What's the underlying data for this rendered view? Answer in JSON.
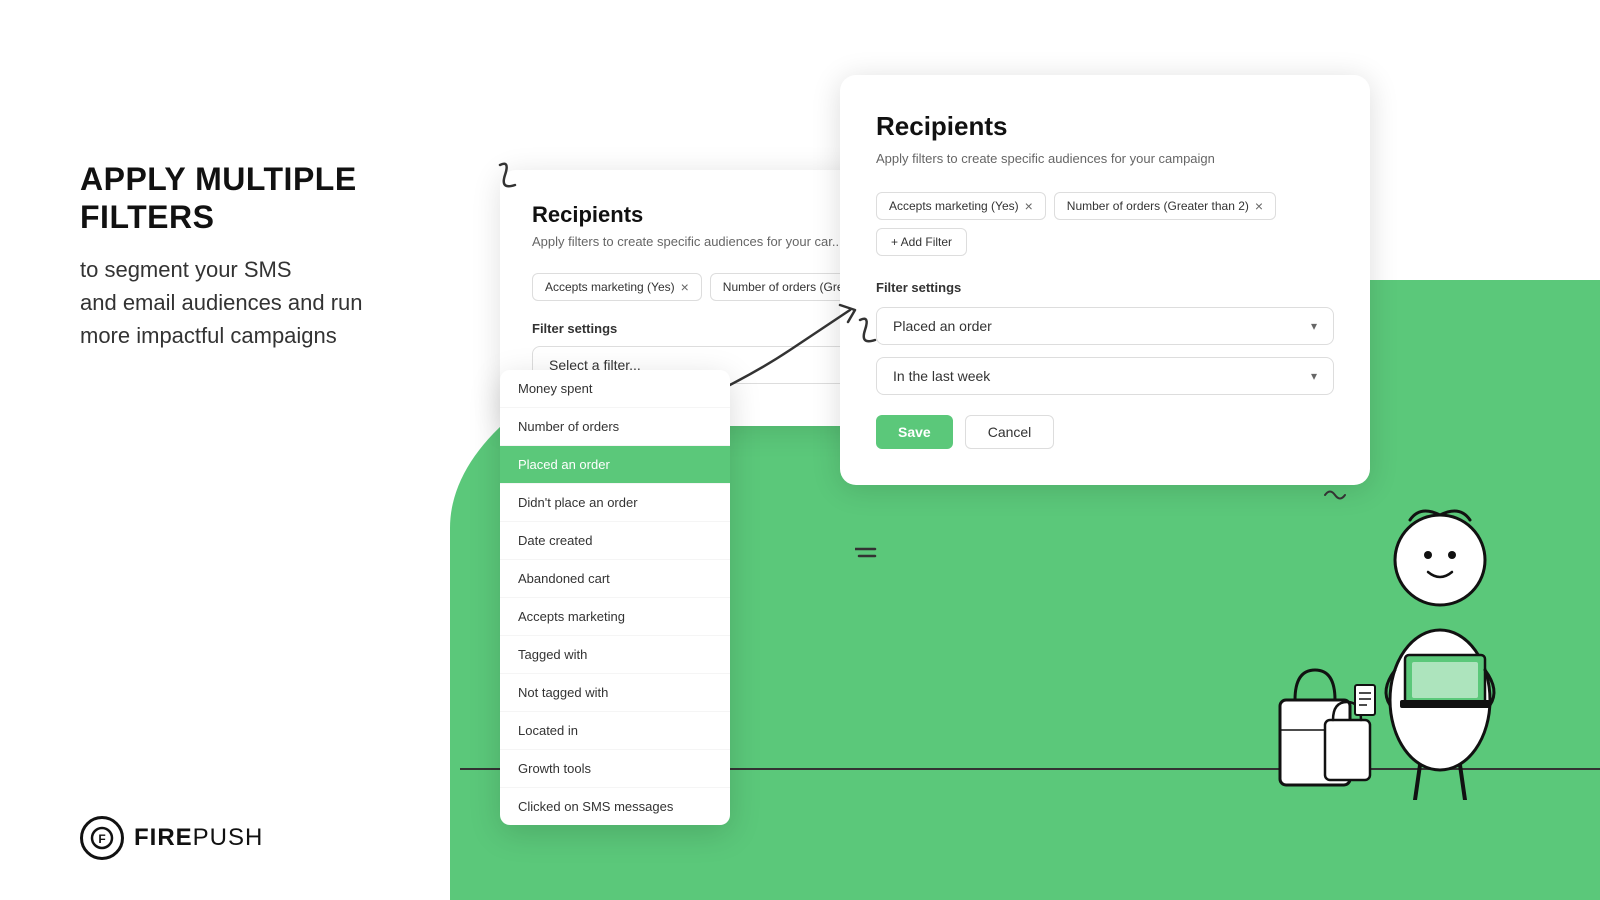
{
  "left": {
    "headline": "APPLY MULTIPLE FILTERS",
    "body_line1": "to segment your SMS",
    "body_line2": "and email audiences and run",
    "body_line3": "more impactful campaigns"
  },
  "logo": {
    "icon": "F",
    "name_bold": "FIRE",
    "name_light": "PUSH"
  },
  "card_back": {
    "title": "Recipients",
    "subtitle": "Apply filters to create specific audiences for your car...",
    "tags": [
      {
        "label": "Accepts marketing (Yes)",
        "removable": true
      },
      {
        "label": "Number of orders (Greater",
        "removable": false
      }
    ],
    "filter_settings_label": "Filter settings",
    "select_placeholder": "Select a filter...",
    "dropdown_items": [
      {
        "label": "Money spent",
        "active": false
      },
      {
        "label": "Number of orders",
        "active": false
      },
      {
        "label": "Placed an order",
        "active": true
      },
      {
        "label": "Didn't place an order",
        "active": false
      },
      {
        "label": "Date created",
        "active": false
      },
      {
        "label": "Abandoned cart",
        "active": false
      },
      {
        "label": "Accepts marketing",
        "active": false
      },
      {
        "label": "Tagged with",
        "active": false
      },
      {
        "label": "Not tagged with",
        "active": false
      },
      {
        "label": "Located in",
        "active": false
      },
      {
        "label": "Growth tools",
        "active": false
      },
      {
        "label": "Clicked on SMS messages",
        "active": false
      }
    ]
  },
  "card_front": {
    "title": "Recipients",
    "subtitle": "Apply filters to create specific audiences for your campaign",
    "tags": [
      {
        "label": "Accepts marketing (Yes)",
        "removable": true
      },
      {
        "label": "Number of orders (Greater than 2)",
        "removable": true
      }
    ],
    "add_filter_label": "+ Add Filter",
    "filter_settings_label": "Filter settings",
    "selected_filter": "Placed an order",
    "second_filter": "In the last week",
    "save_label": "Save",
    "cancel_label": "Cancel"
  },
  "colors": {
    "green": "#5bc87a",
    "dark": "#111111",
    "mid": "#666666",
    "border": "#dddddd"
  }
}
